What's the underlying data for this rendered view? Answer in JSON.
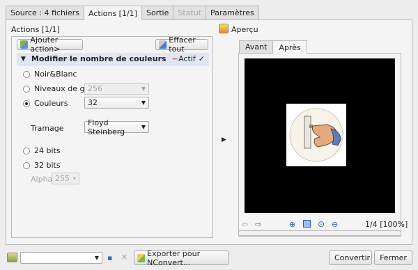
{
  "tabs": [
    {
      "label": "Source : 4 fichiers",
      "state": "normal"
    },
    {
      "label": "Actions [1/1]",
      "state": "active"
    },
    {
      "label": "Sortie",
      "state": "normal"
    },
    {
      "label": "Statut",
      "state": "disabled"
    },
    {
      "label": "Paramètres",
      "state": "normal"
    }
  ],
  "actions": {
    "title": "Actions [1/1]",
    "add_label": "Ajouter action>",
    "clear_label": "Effacer tout",
    "item": {
      "title": "Modifier le nombre de couleurs",
      "active_label": "Actif",
      "active_checked": true
    },
    "options": {
      "bw": "Noir&Blanc",
      "gray": "Niveaux de gris",
      "gray_value": "256",
      "colors": "Couleurs",
      "colors_value": "32",
      "dither_label": "Tramage",
      "dither_value": "Floyd Steinberg",
      "b24": "24 bits",
      "b32": "32 bits",
      "alpha_label": "Alpha",
      "alpha_value": "255"
    }
  },
  "preview": {
    "title": "Aperçu",
    "tabs": [
      {
        "label": "Avant"
      },
      {
        "label": "Après"
      }
    ],
    "page_indicator": "1/4 [100%]"
  },
  "bottom": {
    "combo_value": "",
    "export_label": "Exporter pour NConvert...",
    "convert_label": "Convertir",
    "close_label": "Fermer"
  },
  "colors": {
    "window_bg": "#ededed",
    "header_bg": "#dfe7f3",
    "preview_bg": "#000000"
  }
}
